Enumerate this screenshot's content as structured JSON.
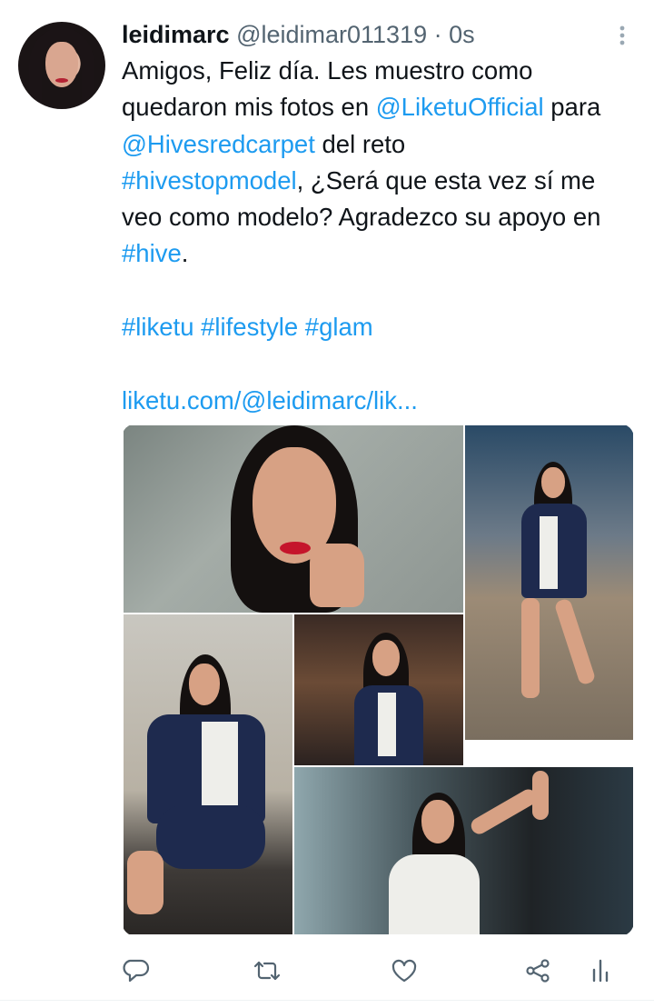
{
  "author": {
    "display_name": "leidimarc",
    "handle": "@leidimar011319",
    "separator": "·",
    "timestamp": "0s"
  },
  "tweet": {
    "t1": "Amigos, Feliz día. Les muestro como quedaron mis fotos en ",
    "mention1": "@LiketuOfficial",
    "t2": " para ",
    "mention2": "@Hivesredcarpet",
    "t3": " del reto ",
    "hashtag1": "#hivestopmodel",
    "t4": ", ¿Será que esta vez sí me veo como modelo? Agradezco su apoyo en ",
    "hashtag2": "#hive",
    "t5": ".",
    "tag_a": "#liketu",
    "tag_b": "#lifestyle",
    "tag_c": "#glam",
    "url": "liketu.com/@leidimarc/lik..."
  },
  "menu": {
    "more_glyph": "⋮"
  },
  "icons": {
    "reply": "reply-icon",
    "retweet": "retweet-icon",
    "like": "heart-icon",
    "share": "share-icon",
    "analytics": "analytics-icon"
  },
  "colors": {
    "link": "#1d9bf0",
    "text": "#0f1419",
    "muted": "#536471",
    "icon": "#536471"
  }
}
